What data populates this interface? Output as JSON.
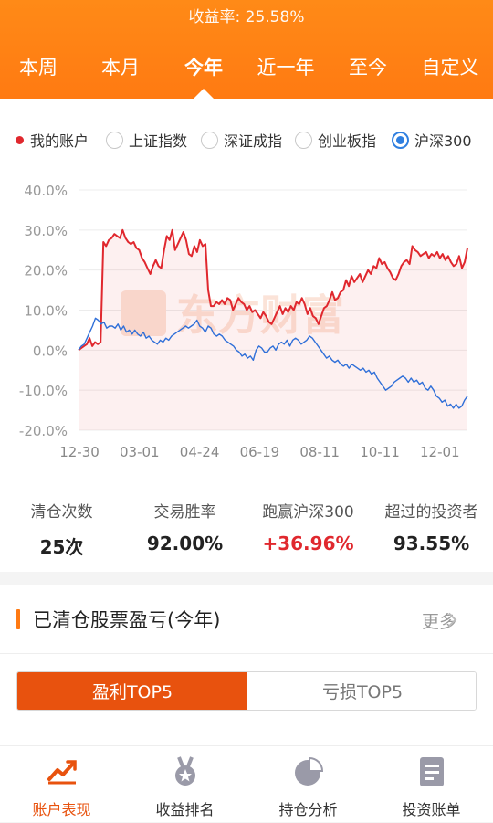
{
  "header": {
    "yield_label": "收益率: 25.58%",
    "tabs": [
      "本周",
      "本月",
      "今年",
      "近一年",
      "至今",
      "自定义"
    ],
    "active_tab": 2
  },
  "legend": {
    "items": [
      {
        "label": "我的账户",
        "kind": "dot",
        "color": "#e0282e"
      },
      {
        "label": "上证指数",
        "kind": "radio",
        "selected": false
      },
      {
        "label": "深证成指",
        "kind": "radio",
        "selected": false
      },
      {
        "label": "创业板指",
        "kind": "radio",
        "selected": false
      },
      {
        "label": "沪深300",
        "kind": "radio",
        "selected": true
      }
    ]
  },
  "chart_data": {
    "type": "line",
    "y_ticks": [
      "40.0%",
      "30.0%",
      "20.0%",
      "10.0%",
      "0.0%",
      "-10.0%",
      "-20.0%"
    ],
    "ylim": [
      -20,
      40
    ],
    "x_ticks": [
      "12-30",
      "03-01",
      "04-24",
      "06-19",
      "08-11",
      "10-11",
      "12-01"
    ],
    "grid": true,
    "watermark": "东方财富",
    "series": [
      {
        "name": "我的账户",
        "color": "#e0282e",
        "values": [
          0,
          0.5,
          1,
          1.5,
          3,
          1,
          2,
          1.5,
          2,
          27,
          26,
          27.5,
          28,
          29,
          28.5,
          28,
          30,
          28,
          27,
          26.5,
          27,
          25.5,
          25,
          23,
          22,
          20.5,
          19,
          21,
          22.5,
          21,
          20.5,
          25,
          28.5,
          27.5,
          30,
          25,
          26.5,
          28,
          29.5,
          27.5,
          24,
          23.5,
          26,
          24.5,
          27.5,
          26,
          26.5,
          15,
          11,
          11,
          12,
          11.5,
          12.5,
          11.5,
          13,
          12.5,
          10,
          11.5,
          13,
          12,
          11.5,
          10,
          11,
          9.5,
          10,
          9,
          8,
          9.5,
          8.5,
          7,
          6.5,
          8,
          9.5,
          11,
          9,
          10.5,
          9.5,
          11,
          10,
          12,
          11.5,
          13,
          11.5,
          9,
          10.5,
          8.5,
          8,
          6.5,
          8.5,
          10.5,
          11,
          12.5,
          14.5,
          12.5,
          13,
          14.5,
          15,
          17.5,
          16,
          18.5,
          17,
          18,
          19,
          17,
          18.5,
          20,
          19,
          21,
          20.5,
          23,
          21.5,
          22,
          20.5,
          19.5,
          18,
          17.5,
          19,
          21,
          22,
          22.5,
          21.5,
          26,
          25,
          24.5,
          23.5,
          24,
          24.5,
          23,
          24,
          23.5,
          24.5,
          23,
          24,
          22.5,
          23.5,
          22,
          21,
          21.5,
          23.5,
          20.5,
          22,
          25.5
        ]
      },
      {
        "name": "沪深300",
        "color": "#2f6fd8",
        "values": [
          0,
          1,
          1.5,
          3,
          4.5,
          6,
          8,
          7.5,
          6.5,
          7,
          5.5,
          6,
          6,
          5.5,
          6.5,
          5,
          6,
          4.5,
          5,
          4,
          5,
          4,
          3.5,
          4.5,
          3,
          3.5,
          2.5,
          2,
          1.5,
          2.5,
          2,
          3,
          2.5,
          3.5,
          4,
          4.5,
          5,
          5.5,
          6,
          5.5,
          6,
          6.5,
          7.5,
          6,
          5.5,
          4.5,
          6,
          5.5,
          4,
          3.5,
          4,
          3.5,
          2.5,
          2,
          1.5,
          1,
          0,
          -0.5,
          -1.5,
          -1,
          -2,
          -1.5,
          -2.5,
          0,
          1,
          0.5,
          -0.5,
          -0.5,
          0.5,
          1,
          0,
          1.5,
          2,
          1.5,
          2.5,
          1,
          2.5,
          3,
          2.5,
          1.5,
          2,
          2.5,
          3.5,
          3,
          2,
          1,
          0,
          -1,
          -2,
          -1.5,
          -2.5,
          -3,
          -2.5,
          -3.5,
          -4,
          -3.5,
          -4.5,
          -3.5,
          -4,
          -4.5,
          -5,
          -4.5,
          -5.5,
          -5,
          -6,
          -5.5,
          -7,
          -8,
          -9,
          -10,
          -9.5,
          -9,
          -8,
          -7.5,
          -7,
          -6.5,
          -7,
          -8,
          -7,
          -8,
          -7.5,
          -8.5,
          -8,
          -9.5,
          -10,
          -9,
          -10,
          -11.5,
          -12,
          -13,
          -12.5,
          -14,
          -13.5,
          -14.5,
          -13.5,
          -14.5,
          -14,
          -12.5,
          -11.5
        ]
      }
    ]
  },
  "stats": [
    {
      "label": "清仓次数",
      "value": "25次",
      "color": "#222222"
    },
    {
      "label": "交易胜率",
      "value": "92.00%",
      "color": "#222222"
    },
    {
      "label": "跑赢沪深300",
      "value": "+36.96%",
      "color": "#e0282e"
    },
    {
      "label": "超过的投资者",
      "value": "93.55%",
      "color": "#222222"
    }
  ],
  "section": {
    "title": "已清仓股票盈亏(今年)",
    "more": "更多",
    "segments": [
      "盈利TOP5",
      "亏损TOP5"
    ],
    "active_segment": 0
  },
  "nav": [
    {
      "label": "账户表现",
      "icon": "chart-trend-icon",
      "active": true
    },
    {
      "label": "收益排名",
      "icon": "medal-icon",
      "active": false
    },
    {
      "label": "持仓分析",
      "icon": "pie-chart-icon",
      "active": false
    },
    {
      "label": "投资账单",
      "icon": "document-icon",
      "active": false
    }
  ]
}
